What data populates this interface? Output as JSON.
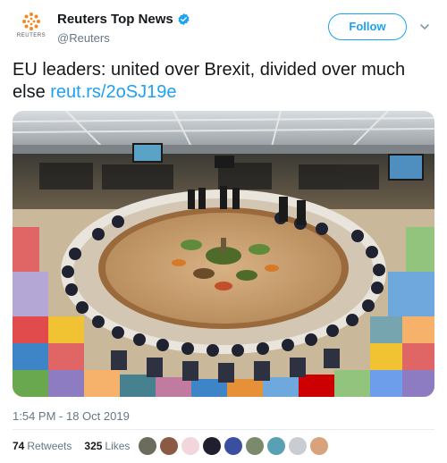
{
  "account": {
    "display_name": "Reuters Top News",
    "handle": "@Reuters",
    "logo_text": "REUTERS"
  },
  "follow_label": "Follow",
  "tweet": {
    "text": "EU leaders: united over Brexit, divided over much else ",
    "link": "reut.rs/2oSJ19e"
  },
  "timestamp": "1:54 PM - 18 Oct 2019",
  "stats": {
    "retweets_count": "74",
    "retweets_label": "Retweets",
    "likes_count": "325",
    "likes_label": "Likes"
  },
  "avatars": [
    {
      "name": "avatar-1",
      "color": "#6b6b5e"
    },
    {
      "name": "avatar-2",
      "color": "#8a5a44"
    },
    {
      "name": "avatar-3",
      "color": "#f2d6dc"
    },
    {
      "name": "avatar-4",
      "color": "#1f1f2e"
    },
    {
      "name": "avatar-5",
      "color": "#3a4fa0"
    },
    {
      "name": "avatar-6",
      "color": "#7a8a6a"
    },
    {
      "name": "avatar-7",
      "color": "#5aa0b4"
    },
    {
      "name": "avatar-8",
      "color": "#c9ccd1"
    },
    {
      "name": "avatar-9",
      "color": "#d8a27a"
    }
  ],
  "colors": {
    "accent": "#1da1f2",
    "secondary_text": "#657786",
    "verified": "#1da1f2"
  },
  "icons": [
    "reuters-logo-icon",
    "verified-badge-icon",
    "chevron-down-icon"
  ]
}
